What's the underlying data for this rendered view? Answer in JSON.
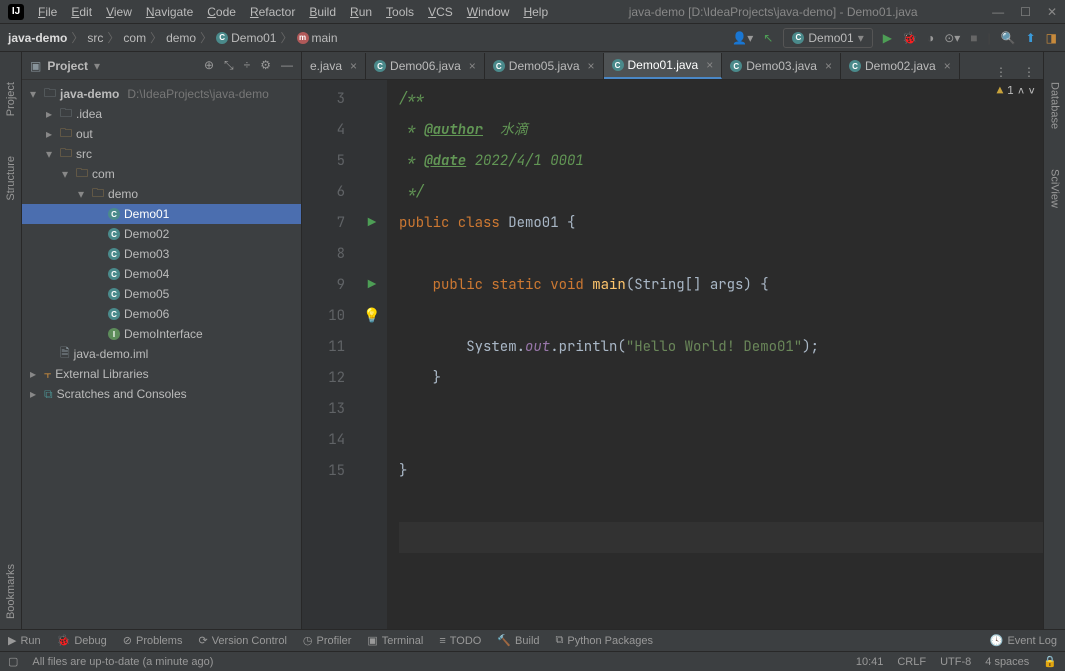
{
  "window": {
    "title": "java-demo [D:\\IdeaProjects\\java-demo] - Demo01.java"
  },
  "menu": [
    "File",
    "Edit",
    "View",
    "Navigate",
    "Code",
    "Refactor",
    "Build",
    "Run",
    "Tools",
    "VCS",
    "Window",
    "Help"
  ],
  "breadcrumbs": [
    {
      "label": "java-demo",
      "bold": true
    },
    {
      "label": "src"
    },
    {
      "label": "com"
    },
    {
      "label": "demo"
    },
    {
      "label": "Demo01",
      "icon": "C"
    },
    {
      "label": "main",
      "icon": "m"
    }
  ],
  "runconfig": "Demo01",
  "project": {
    "header": "Project",
    "root": {
      "name": "java-demo",
      "path": "D:\\IdeaProjects\\java-demo"
    },
    "children": [
      {
        "name": ".idea",
        "type": "folder",
        "open": false,
        "indent": 1
      },
      {
        "name": "out",
        "type": "folder-orange",
        "open": false,
        "indent": 1
      },
      {
        "name": "src",
        "type": "folder",
        "open": true,
        "indent": 1
      },
      {
        "name": "com",
        "type": "folder",
        "open": true,
        "indent": 2
      },
      {
        "name": "demo",
        "type": "folder",
        "open": true,
        "indent": 3
      },
      {
        "name": "Demo01",
        "type": "class",
        "indent": 4,
        "selected": true
      },
      {
        "name": "Demo02",
        "type": "class",
        "indent": 4
      },
      {
        "name": "Demo03",
        "type": "class",
        "indent": 4
      },
      {
        "name": "Demo04",
        "type": "class",
        "indent": 4
      },
      {
        "name": "Demo05",
        "type": "class",
        "indent": 4
      },
      {
        "name": "Demo06",
        "type": "class",
        "indent": 4
      },
      {
        "name": "DemoInterface",
        "type": "interface",
        "indent": 4
      },
      {
        "name": "java-demo.iml",
        "type": "file",
        "indent": 1
      }
    ],
    "externalLibs": "External Libraries",
    "scratches": "Scratches and Consoles"
  },
  "tabs": [
    {
      "label": "e.java",
      "partial": true
    },
    {
      "label": "Demo06.java"
    },
    {
      "label": "Demo05.java"
    },
    {
      "label": "Demo01.java",
      "active": true
    },
    {
      "label": "Demo03.java"
    },
    {
      "label": "Demo02.java"
    }
  ],
  "code": {
    "startLine": 3,
    "lines": [
      {
        "n": 3,
        "html": "<span class='cm'>/**</span>"
      },
      {
        "n": 4,
        "html": "<span class='cm'> * <span class='tag'>@author</span>  水滴</span>"
      },
      {
        "n": 5,
        "html": "<span class='cm'> * <span class='tag'>@date</span> 2022/4/1 0001</span>"
      },
      {
        "n": 6,
        "html": "<span class='cm'> */</span>"
      },
      {
        "n": 7,
        "html": "<span class='kw'>public class</span> Demo01 {",
        "run": true
      },
      {
        "n": 8,
        "html": ""
      },
      {
        "n": 9,
        "html": "    <span class='kw'>public static void</span> <span class='fn'>main</span>(String[] args) {",
        "run": true
      },
      {
        "n": 10,
        "html": "        System.<span class='st'>out</span>.println(<span class='str'>\"Hello World! Demo01\"</span>);",
        "bulb": true,
        "caret": true
      },
      {
        "n": 11,
        "html": "    }"
      },
      {
        "n": 12,
        "html": ""
      },
      {
        "n": 13,
        "html": ""
      },
      {
        "n": 14,
        "html": "}"
      },
      {
        "n": 15,
        "html": ""
      }
    ],
    "warnCount": 1
  },
  "leftRail": [
    "Project",
    "Structure",
    "Bookmarks"
  ],
  "rightRail": [
    "Database",
    "SciView"
  ],
  "bottomTools": [
    {
      "icon": "▶",
      "label": "Run"
    },
    {
      "icon": "🐞",
      "label": "Debug"
    },
    {
      "icon": "⊘",
      "label": "Problems"
    },
    {
      "icon": "⟳",
      "label": "Version Control"
    },
    {
      "icon": "◷",
      "label": "Profiler"
    },
    {
      "icon": "▣",
      "label": "Terminal"
    },
    {
      "icon": "≡",
      "label": "TODO"
    },
    {
      "icon": "🔨",
      "label": "Build"
    },
    {
      "icon": "⧉",
      "label": "Python Packages"
    }
  ],
  "eventLog": "Event Log",
  "status": {
    "msg": "All files are up-to-date (a minute ago)",
    "time": "10:41",
    "eol": "CRLF",
    "enc": "UTF-8",
    "indent": "4 spaces"
  }
}
